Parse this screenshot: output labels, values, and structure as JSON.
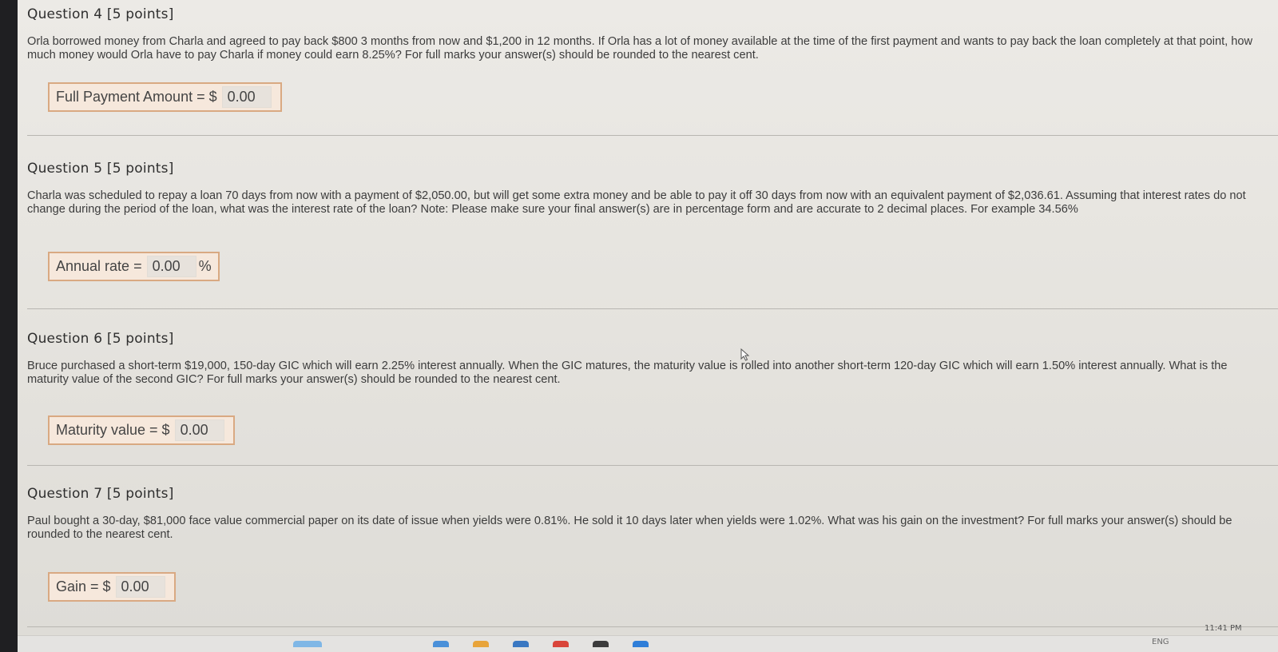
{
  "questions": [
    {
      "title": "Question 4 [5 points]",
      "text": "Orla borrowed money from Charla and agreed to pay back $800 3 months from now and $1,200 in 12 months. If Orla has a lot of money available at the time of the first payment and wants to pay back the loan completely at that point, how much money would Orla have to pay Charla if money could earn 8.25%? For full marks your answer(s) should be rounded to the nearest cent.",
      "answer_label": "Full Payment Amount = $",
      "answer_value": "0.00",
      "answer_suffix": ""
    },
    {
      "title": "Question 5 [5 points]",
      "text": "Charla was scheduled to repay a loan 70 days from now with a payment of $2,050.00, but will get some extra money and be able to pay it off 30 days from now with an equivalent payment of $2,036.61. Assuming that interest rates do not change during the period of the loan, what was the interest rate of the loan? Note: Please make sure your final answer(s) are in percentage form and are accurate to 2 decimal places. For example 34.56%",
      "answer_label": "Annual rate =",
      "answer_value": "0.00",
      "answer_suffix": "%"
    },
    {
      "title": "Question 6 [5 points]",
      "text": "Bruce purchased a short-term $19,000, 150-day GIC which will earn 2.25% interest annually. When the GIC matures, the maturity value is rolled into another short-term 120-day GIC which will earn 1.50% interest annually. What is the maturity value of the second GIC? For full marks your answer(s) should be rounded to the nearest cent.",
      "answer_label": "Maturity value = $",
      "answer_value": "0.00",
      "answer_suffix": ""
    },
    {
      "title": "Question 7 [5 points]",
      "text": "Paul bought a 30-day, $81,000 face value commercial paper on its date of issue when yields were 0.81%. He sold it 10 days later when yields were 1.02%. What was his gain on the investment? For full marks your answer(s) should be rounded to the nearest cent.",
      "answer_label": "Gain = $",
      "answer_value": "0.00",
      "answer_suffix": ""
    }
  ],
  "taskbar": {
    "language": "ENG",
    "time": "11:41 PM"
  },
  "colors": {
    "answer_border": "#d9a982",
    "answer_bg": "#f6e8dc"
  }
}
